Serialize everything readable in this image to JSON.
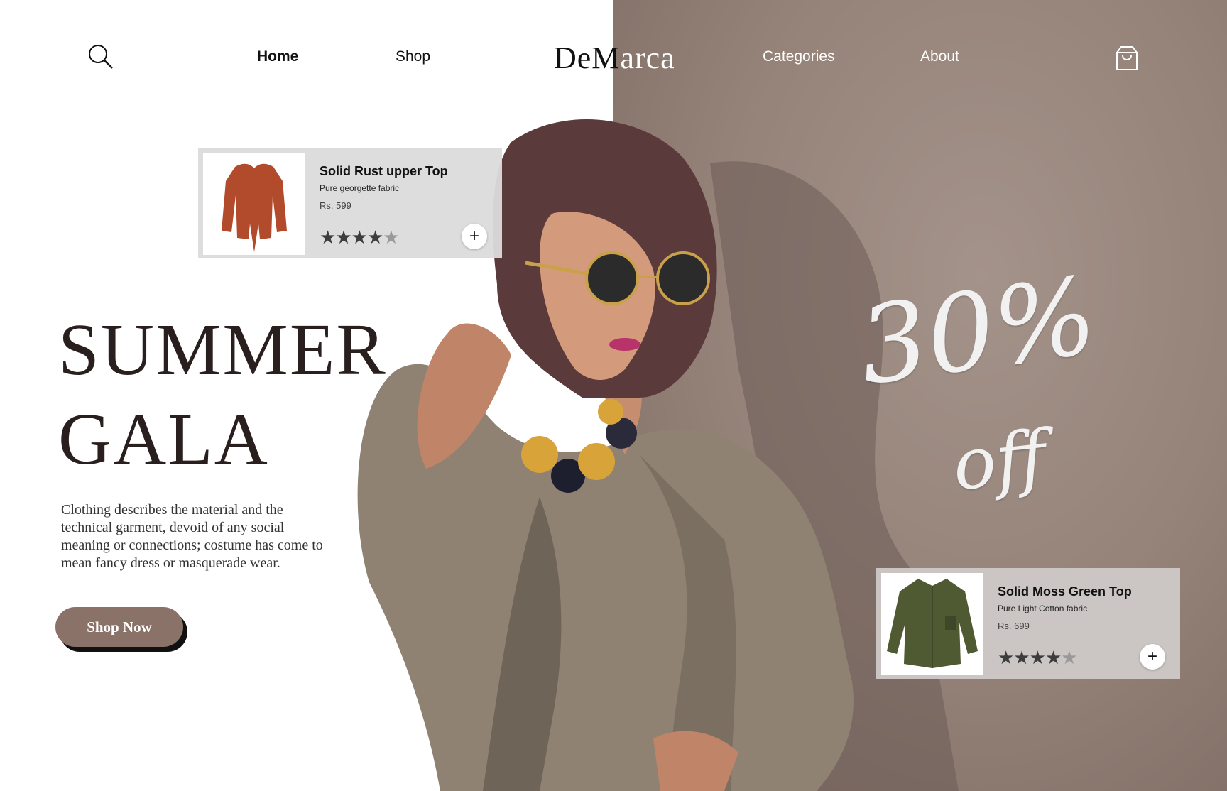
{
  "brand": {
    "logo_part1": "DeM",
    "logo_part2": "arca"
  },
  "nav": {
    "home": "Home",
    "shop": "Shop",
    "categories": "Categories",
    "about": "About"
  },
  "icons": {
    "search": "search-icon",
    "cart": "shopping-bag-icon",
    "add": "plus-icon",
    "star": "star-icon"
  },
  "hero": {
    "title_line1": "SUMMER",
    "title_line2": "GALA",
    "description": "Clothing describes the material and the technical garment, devoid of any social meaning or connections; costume has come to mean fancy dress or masquerade wear.",
    "cta": "Shop Now"
  },
  "promo": {
    "percent": "30%",
    "suffix": "off"
  },
  "products": [
    {
      "name": "Solid Rust upper Top",
      "fabric": "Pure georgette fabric",
      "price": "Rs. 599",
      "rating": 4,
      "max_rating": 5,
      "add_label": "+",
      "color": "#b24a2c"
    },
    {
      "name": "Solid Moss Green Top",
      "fabric": "Pure Light Cotton fabric",
      "price": "Rs. 699",
      "rating": 4,
      "max_rating": 5,
      "add_label": "+",
      "color": "#4f5a33"
    }
  ],
  "colors": {
    "accent": "#8a7268",
    "background_right": "#958379",
    "card_bg": "#dcdbdb"
  }
}
